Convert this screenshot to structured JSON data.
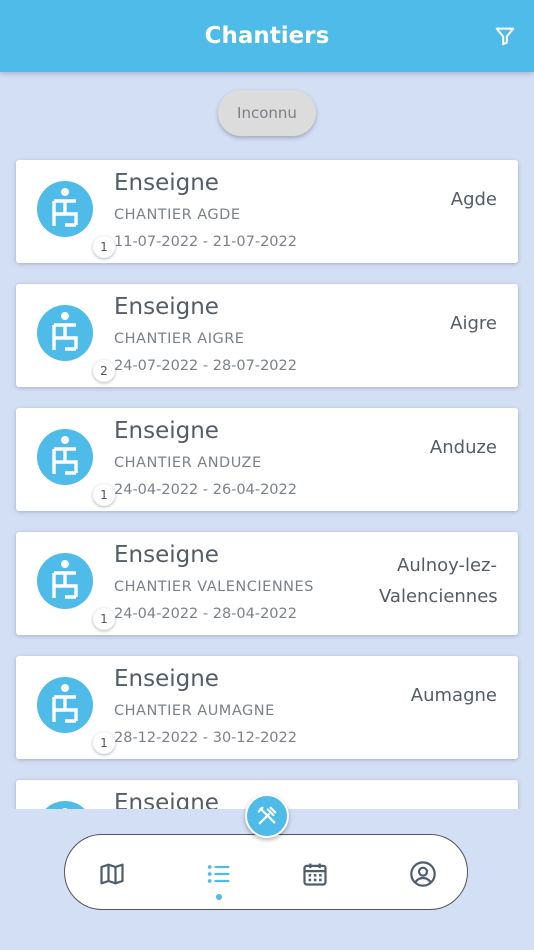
{
  "header": {
    "title": "Chantiers"
  },
  "filter_chip": {
    "label": "Inconnu"
  },
  "cards": [
    {
      "title": "Enseigne",
      "name": "CHANTIER AGDE",
      "dates": "11-07-2022 - 21-07-2022",
      "city": "Agde",
      "badge": "1"
    },
    {
      "title": "Enseigne",
      "name": "CHANTIER AIGRE",
      "dates": "24-07-2022 - 28-07-2022",
      "city": "Aigre",
      "badge": "2"
    },
    {
      "title": "Enseigne",
      "name": "CHANTIER ANDUZE",
      "dates": "24-04-2022 - 26-04-2022",
      "city": "Anduze",
      "badge": "1"
    },
    {
      "title": "Enseigne",
      "name": "CHANTIER VALENCIENNES",
      "dates": "24-04-2022 - 28-04-2022",
      "city": "Aulnoy-lez-Valenciennes",
      "badge": "1"
    },
    {
      "title": "Enseigne",
      "name": "CHANTIER AUMAGNE",
      "dates": "28-12-2022 - 30-12-2022",
      "city": "Aumagne",
      "badge": "1"
    },
    {
      "title": "Enseigne",
      "name": "",
      "dates": "",
      "city": "",
      "badge": ""
    }
  ],
  "nav": {
    "items": [
      "map-icon",
      "list-icon",
      "calendar-icon",
      "account-icon"
    ],
    "active": "list-icon"
  },
  "colors": {
    "accent": "#4fbbe8",
    "background": "#d3dff5"
  }
}
